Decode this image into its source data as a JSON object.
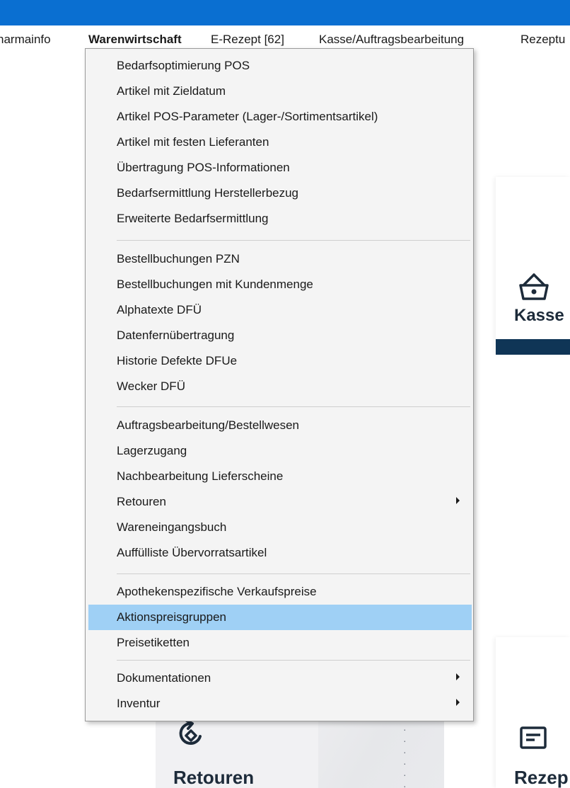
{
  "menubar": {
    "items": [
      {
        "label": "harmainfo"
      },
      {
        "label": "Warenwirtschaft"
      },
      {
        "label": "E-Rezept [62]"
      },
      {
        "label": "Kasse/Auftragsbearbeitung"
      },
      {
        "label": "Rezeptu"
      }
    ],
    "active": "Warenwirtschaft"
  },
  "dropdown": {
    "items": [
      {
        "label": "Bedarfsoptimierung POS"
      },
      {
        "label": "Artikel mit Zieldatum"
      },
      {
        "label": "Artikel POS-Parameter (Lager-/Sortimentsartikel)"
      },
      {
        "label": "Artikel mit festen Lieferanten"
      },
      {
        "label": "Übertragung POS-Informationen"
      },
      {
        "label": "Bedarfsermittlung Herstellerbezug"
      },
      {
        "label": "Erweiterte Bedarfsermittlung"
      },
      {
        "label": "Bestellbuchungen PZN"
      },
      {
        "label": "Bestellbuchungen mit Kundenmenge"
      },
      {
        "label": "Alphatexte DFÜ"
      },
      {
        "label": "Datenfernübertragung"
      },
      {
        "label": "Historie Defekte DFUe"
      },
      {
        "label": "Wecker DFÜ"
      },
      {
        "label": "Auftragsbearbeitung/Bestellwesen"
      },
      {
        "label": "Lagerzugang"
      },
      {
        "label": "Nachbearbeitung Lieferscheine"
      },
      {
        "label": "Retouren",
        "submenu": true
      },
      {
        "label": "Wareneingangsbuch"
      },
      {
        "label": "Auffülliste Übervorratsartikel"
      },
      {
        "label": "Apothekenspezifische Verkaufspreise"
      },
      {
        "label": "Aktionspreisgruppen",
        "highlighted": true
      },
      {
        "label": "Preisetiketten"
      },
      {
        "label": "Dokumentationen",
        "submenu": true
      },
      {
        "label": "Inventur",
        "submenu": true
      }
    ]
  },
  "tiles": {
    "kasse": {
      "label": "Kasse",
      "icon": "shopping-basket-icon"
    },
    "retouren": {
      "label": "Retouren",
      "icon": "return-arrow-icon"
    },
    "rezept": {
      "label": "Rezep",
      "icon": "prescription-card-icon"
    }
  },
  "colors": {
    "titlebar": "#0a6fd1",
    "highlight": "#9fd0f5",
    "tile_accent": "#0f3556"
  }
}
